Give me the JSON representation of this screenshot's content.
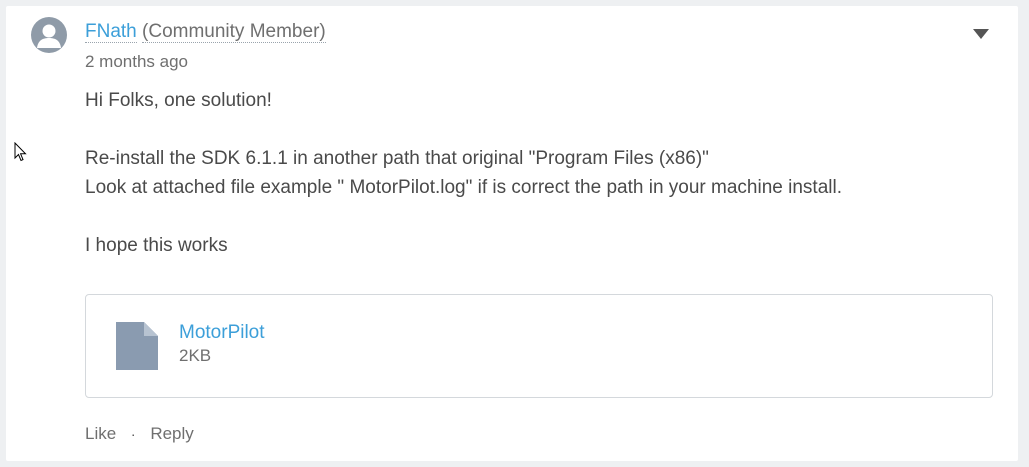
{
  "comment": {
    "author": {
      "name": "FNath",
      "role": "(Community Member)"
    },
    "timestamp": "2 months ago",
    "menu_icon": "caret-down-icon",
    "body": [
      "Hi Folks, one solution!",
      "",
      "Re-install the SDK 6.1.1 in another path that original \"Program Files (x86)\"",
      "Look at attached file example \" MotorPilot.log\" if is correct the path in your machine install.",
      "",
      "I hope this works"
    ],
    "attachment": {
      "name": "MotorPilot",
      "size": "2KB",
      "icon": "file-icon"
    },
    "actions": {
      "like": "Like",
      "separator": "·",
      "reply": "Reply"
    }
  },
  "colors": {
    "link": "#3c9fd9",
    "text": "#4a4a4a",
    "muted": "#6f6f6f",
    "avatar": "#8f9ba8",
    "file_icon": "#8a9bb0",
    "background": "#eef0f2"
  }
}
